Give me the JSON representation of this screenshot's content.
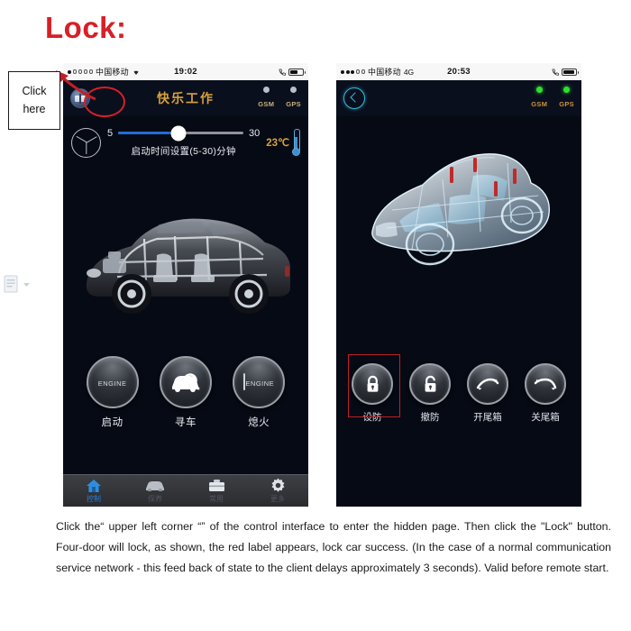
{
  "page": {
    "heading": "Lock:",
    "heading_color": "#d81f26",
    "description": "Click the“  upper left corner “”  of the control interface to enter the hidden page. Then click the \"Lock\" button. Four-door will lock, as shown, the red label appears, lock car success. (In the case of a normal communication service network - this feed back of state to the client delays approximately 3 seconds). Valid before remote start."
  },
  "callout": {
    "line1": "Click",
    "line2": "here",
    "arrow_color": "#c01f28",
    "box_border_color": "#1a1a1a"
  },
  "margin_icon": {
    "name": "document-icon",
    "dropdown": "▾"
  },
  "phone_left": {
    "status_bar": {
      "carrier": "中国移动",
      "network": "",
      "wifi_icon": "wifi-icon",
      "time": "19:02",
      "battery_level": 60,
      "signal_filled": 1,
      "signal_hollow": 4
    },
    "header": {
      "menu_icon": "app-menu-icon",
      "title": "快乐工作",
      "title_color": "#d8a13a",
      "indicators": [
        {
          "label": "GSM",
          "state": "off"
        },
        {
          "label": "GPS",
          "state": "off"
        }
      ],
      "annotation_circle_color": "#d81f26"
    },
    "slider": {
      "brand_icon": "mercedes-benz-logo",
      "min": "5",
      "max": "30",
      "value_percent": 48,
      "caption": "启动时间设置(5-30)分钟",
      "temperature": "23℃",
      "thermometer_icon": "thermometer-icon"
    },
    "car_image": "car-cutaway-side-view",
    "actions": [
      {
        "label": "启动",
        "icon": "engine-start-icon",
        "glyph_text": "ENGINE"
      },
      {
        "label": "寻车",
        "icon": "find-car-icon",
        "glyph_text": ""
      },
      {
        "label": "熄火",
        "icon": "engine-stop-icon",
        "glyph_text": "ENGINE"
      }
    ],
    "tabs": [
      {
        "label": "控制",
        "icon": "home-icon",
        "active": true
      },
      {
        "label": "保养",
        "icon": "car-icon",
        "active": false
      },
      {
        "label": "常用",
        "icon": "briefcase-icon",
        "active": false
      },
      {
        "label": "更多",
        "icon": "gear-icon",
        "active": false
      }
    ]
  },
  "phone_right": {
    "status_bar": {
      "carrier": "中国移动",
      "network": "4G",
      "time": "20:53",
      "battery_level": 90,
      "signal_filled": 3,
      "signal_hollow": 2
    },
    "header": {
      "back_icon": "back-chevron-icon",
      "title": "",
      "indicators": [
        {
          "label": "GSM",
          "state": "on"
        },
        {
          "label": "GPS",
          "state": "on"
        }
      ]
    },
    "car_image": "car-xray-3d-view-with-door-lock-pins",
    "lock_pins": 4,
    "lock_pin_color": "#c02a2a",
    "actions": [
      {
        "label": "设防",
        "icon": "lock-closed-icon",
        "highlighted": true
      },
      {
        "label": "撤防",
        "icon": "lock-open-icon",
        "highlighted": false
      },
      {
        "label": "开尾箱",
        "icon": "trunk-open-icon",
        "highlighted": false
      },
      {
        "label": "关尾箱",
        "icon": "trunk-close-icon",
        "highlighted": false
      }
    ],
    "highlight_color": "#c01f28"
  }
}
